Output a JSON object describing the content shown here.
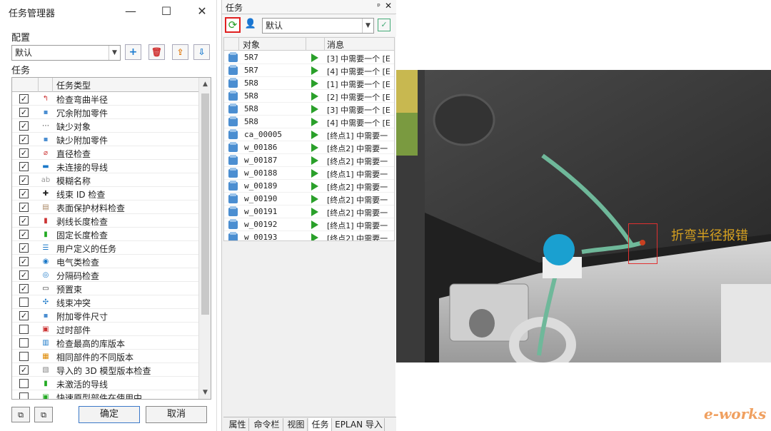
{
  "task_manager": {
    "title": "任务管理器",
    "config_label": "配置",
    "config_value": "默认",
    "tasks_label": "任务",
    "column_task_type": "任务类型",
    "rows": [
      {
        "label": "检查弯曲半径",
        "checked": true,
        "icon": "bend-icon"
      },
      {
        "label": "冗余附加零件",
        "checked": true,
        "icon": "part-icon"
      },
      {
        "label": "缺少对象",
        "checked": true,
        "icon": "missing-object-icon"
      },
      {
        "label": "缺少附加零件",
        "checked": true,
        "icon": "part-icon"
      },
      {
        "label": "直径检查",
        "checked": true,
        "icon": "diameter-icon"
      },
      {
        "label": "未连接的导线",
        "checked": true,
        "icon": "wire-icon"
      },
      {
        "label": "模糊名称",
        "checked": true,
        "icon": "name-icon"
      },
      {
        "label": "线束 ID 检查",
        "checked": true,
        "icon": "harness-id-icon"
      },
      {
        "label": "表面保护材料检查",
        "checked": true,
        "icon": "protection-icon"
      },
      {
        "label": "剥线长度检查",
        "checked": true,
        "icon": "strip-icon"
      },
      {
        "label": "固定长度检查",
        "checked": true,
        "icon": "fixed-length-icon"
      },
      {
        "label": "用户定义的任务",
        "checked": true,
        "icon": "user-task-icon"
      },
      {
        "label": "电气类检查",
        "checked": true,
        "icon": "electrical-icon"
      },
      {
        "label": "分隔码检查",
        "checked": true,
        "icon": "separator-icon"
      },
      {
        "label": "预置束",
        "checked": true,
        "icon": "preset-icon"
      },
      {
        "label": "线束冲突",
        "checked": false,
        "icon": "conflict-icon"
      },
      {
        "label": "附加零件尺寸",
        "checked": true,
        "icon": "part-icon"
      },
      {
        "label": "过时部件",
        "checked": false,
        "icon": "obsolete-icon"
      },
      {
        "label": "检查最高的库版本",
        "checked": false,
        "icon": "library-icon"
      },
      {
        "label": "相同部件的不同版本",
        "checked": false,
        "icon": "version-icon"
      },
      {
        "label": "导入的 3D 模型版本检查",
        "checked": true,
        "icon": "model-icon"
      },
      {
        "label": "未激活的导线",
        "checked": false,
        "icon": "inactive-wire-icon"
      },
      {
        "label": "快速原型部件在使用中",
        "checked": false,
        "icon": "prototype-icon"
      }
    ],
    "ok_label": "确定",
    "cancel_label": "取消"
  },
  "tasks_panel": {
    "title": "任务",
    "filter_value": "默认",
    "column_object": "对象",
    "column_message": "消息",
    "rows": [
      {
        "object": "5R7",
        "message": "[3] 中需要一个 [E"
      },
      {
        "object": "5R7",
        "message": "[4] 中需要一个 [E"
      },
      {
        "object": "5R8",
        "message": "[1] 中需要一个 [E"
      },
      {
        "object": "5R8",
        "message": "[2] 中需要一个 [E"
      },
      {
        "object": "5R8",
        "message": "[3] 中需要一个 [E"
      },
      {
        "object": "5R8",
        "message": "[4] 中需要一个 [E"
      },
      {
        "object": "ca_00005",
        "message": "[终点1] 中需要一"
      },
      {
        "object": "w_00186",
        "message": "[终点2] 中需要一"
      },
      {
        "object": "w_00187",
        "message": "[终点2] 中需要一"
      },
      {
        "object": "w_00188",
        "message": "[终点1] 中需要一"
      },
      {
        "object": "w_00189",
        "message": "[终点2] 中需要一"
      },
      {
        "object": "w_00190",
        "message": "[终点2] 中需要一"
      },
      {
        "object": "w_00191",
        "message": "[终点2] 中需要一"
      },
      {
        "object": "w_00192",
        "message": "[终点1] 中需要一"
      },
      {
        "object": "w_00193",
        "message": "[终点2] 中需要一"
      }
    ],
    "tabs": [
      "属性",
      "命令栏",
      "视图",
      "任务",
      "EPLAN 导入"
    ]
  },
  "viewport": {
    "annotation": "折弯半径报错"
  },
  "watermark": "e-works"
}
